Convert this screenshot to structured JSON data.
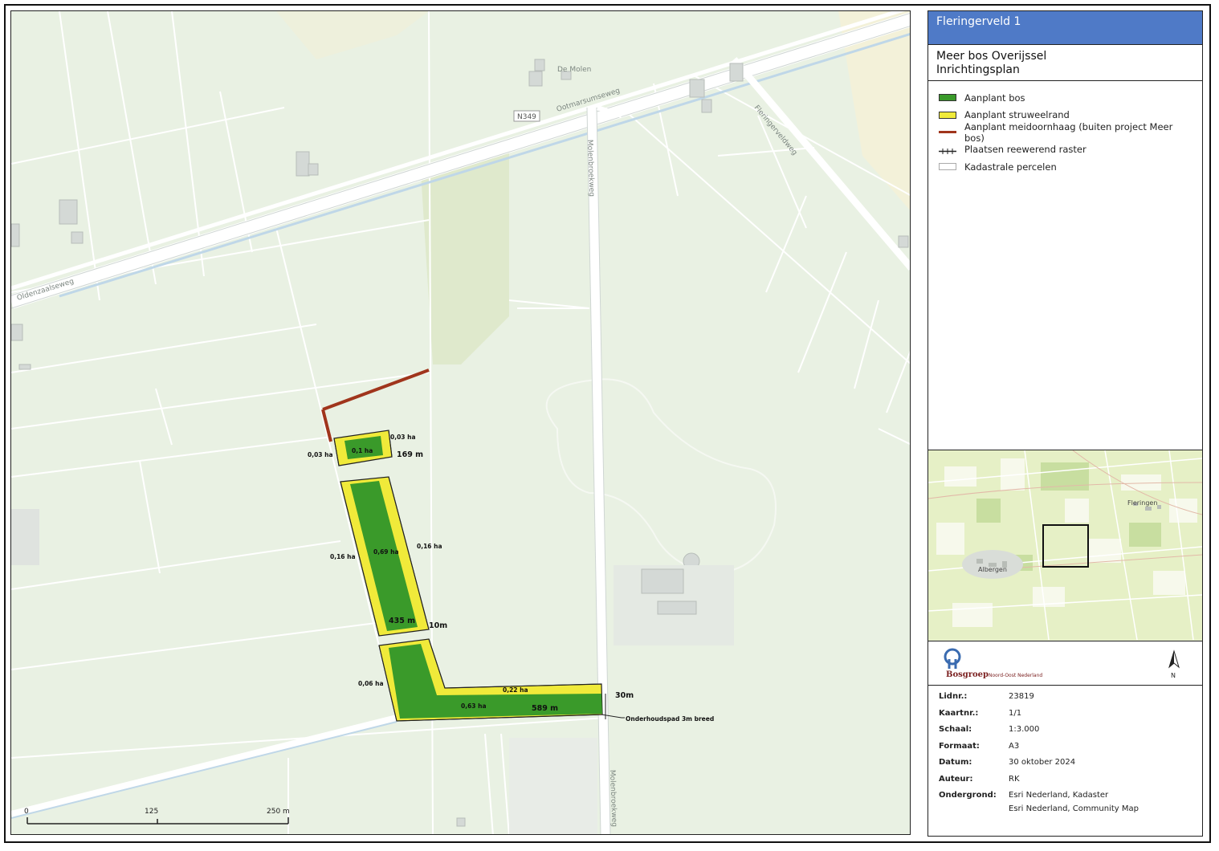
{
  "title": "Fleringerveld 1",
  "subtitle_line1": "Meer bos Overijssel",
  "subtitle_line2": "Inrichtingsplan",
  "legend": [
    {
      "label": "Aanplant bos",
      "color": "#3a9a2a",
      "kind": "fill"
    },
    {
      "label": "Aanplant struweelrand",
      "color": "#f0ea3a",
      "kind": "fill"
    },
    {
      "label": "Aanplant meidoornhaag (buiten project Meer bos)",
      "color": "#a0351c",
      "kind": "line"
    },
    {
      "label": "Plaatsen reewerend raster",
      "color": "#222222",
      "kind": "fence"
    },
    {
      "label": "Kadastrale percelen",
      "color": "#ffffff",
      "kind": "outline"
    }
  ],
  "map": {
    "place_labels": [
      "De Molen",
      "Oldenzaalseweg",
      "Ootmarsumseweg",
      "N349",
      "Molenbroekweg",
      "Fleringerveldweg",
      "Molenbroekweg"
    ],
    "area_labels": {
      "a1": "0,1 ha",
      "a1_left": "0,03 ha",
      "a1_right": "0,03 ha",
      "len1": "169 m",
      "a2": "0,69 ha",
      "a2_left": "0,16 ha",
      "a2_right": "0,16 ha",
      "len2": "435 m",
      "w10": "10m",
      "a3_left": "0,06 ha",
      "a3_strip": "0,22 ha",
      "a3": "0,63 ha",
      "len3": "589 m",
      "w30": "30m",
      "path": "Onderhoudspad 3m breed"
    },
    "scale": {
      "t0": "0",
      "t1": "125",
      "t2": "250 m"
    }
  },
  "overview": {
    "label1": "Fleringen",
    "label2": "Albergen"
  },
  "logo": {
    "name": "Bosgroep",
    "tagline": "Noord-Oost Nederland",
    "north": "N"
  },
  "meta": [
    {
      "key": "Lidnr.:",
      "value": "23819"
    },
    {
      "key": "Kaartnr.:",
      "value": "1/1"
    },
    {
      "key": "Schaal:",
      "value": "1:3.000"
    },
    {
      "key": "Formaat:",
      "value": "A3"
    },
    {
      "key": "Datum:",
      "value": "30 oktober 2024"
    },
    {
      "key": "Auteur:",
      "value": "RK"
    },
    {
      "key": "Ondergrond:",
      "value": "Esri Nederland, Kadaster"
    }
  ],
  "meta_extra": "Esri Nederland, Community Map"
}
